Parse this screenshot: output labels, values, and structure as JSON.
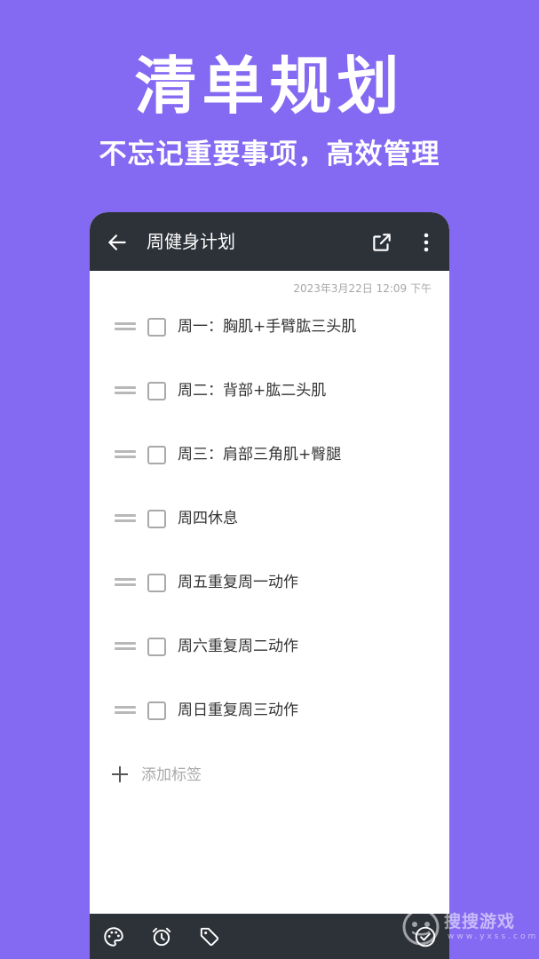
{
  "promo": {
    "title": "清单规划",
    "subtitle": "不忘记重要事项，高效管理"
  },
  "app_bar": {
    "title": "周健身计划",
    "icons": [
      "arrow-left-icon",
      "share-icon",
      "more-vertical-icon"
    ]
  },
  "note": {
    "timestamp": "2023年3月22日 12:09 下午",
    "items": [
      {
        "text": "周一：胸肌+手臂肱三头肌",
        "checked": false
      },
      {
        "text": "周二：背部+肱二头肌",
        "checked": false
      },
      {
        "text": "周三：肩部三角肌+臀腿",
        "checked": false
      },
      {
        "text": "周四休息",
        "checked": false
      },
      {
        "text": "周五重复周一动作",
        "checked": false
      },
      {
        "text": "周六重复周二动作",
        "checked": false
      },
      {
        "text": "周日重复周三动作",
        "checked": false
      }
    ],
    "add_tag_label": "添加标签"
  },
  "bottom_bar": {
    "icons": [
      "palette-icon",
      "alarm-icon",
      "tag-icon",
      "check-circle-icon"
    ]
  },
  "watermark": {
    "text": "搜搜游戏",
    "sub": "www.yxss.com"
  },
  "colors": {
    "background": "#8469f2",
    "bar": "#2d3138",
    "text": "#333333",
    "muted": "#a9a9a9"
  }
}
